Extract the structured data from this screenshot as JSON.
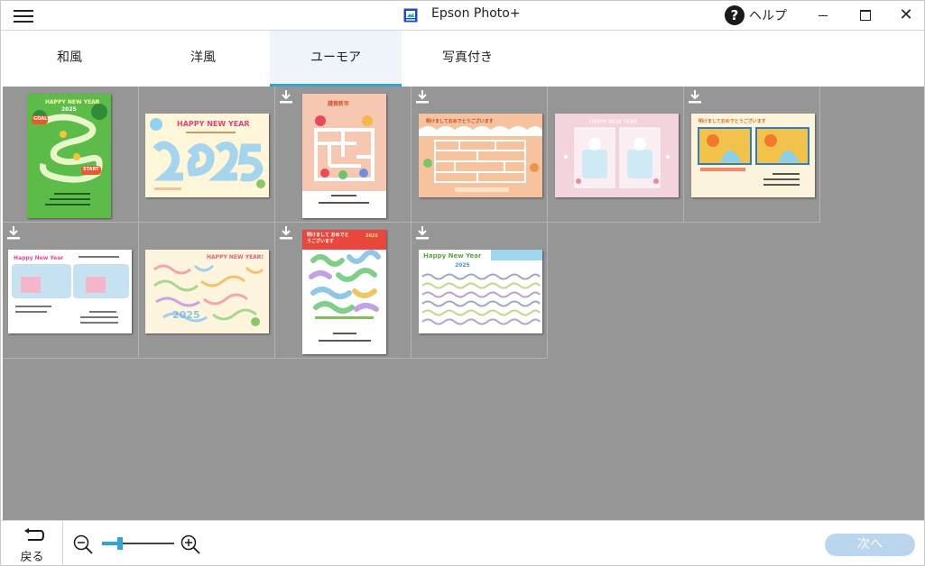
{
  "titlebar": {
    "title": "Epson Photo+",
    "help_label": "ヘルプ",
    "close_glyph": "✕"
  },
  "tabs": [
    {
      "label": "和風",
      "active": false
    },
    {
      "label": "洋風",
      "active": false
    },
    {
      "label": "ユーモア",
      "active": true
    },
    {
      "label": "写真付き",
      "active": false
    }
  ],
  "templates": [
    {
      "caption": "HAPPY NEW YEAR",
      "caption2": "2025",
      "tag_goal": "GOAL",
      "tag_start": "START",
      "downloadable": false,
      "bg": "#5dbb4a"
    },
    {
      "caption": "HAPPY NEW YEAR",
      "year": "2025",
      "downloadable": false,
      "bg": "#fdf6d8"
    },
    {
      "caption": "謹賀新年",
      "downloadable": true,
      "bg": "#f6c7b1"
    },
    {
      "caption": "明けましておめでとうございます",
      "downloadable": true,
      "bg": "#f6c39e"
    },
    {
      "caption": "HAPPY NEW YEAR",
      "downloadable": false,
      "bg": "#f3d3dc"
    },
    {
      "caption": "明けましておめでとうございます",
      "downloadable": true,
      "bg": "#fbf3dc"
    },
    {
      "caption": "Happy New Year",
      "downloadable": true,
      "bg": "#ffffff"
    },
    {
      "caption": "HAPPY NEW YEAR!",
      "year": "2025",
      "downloadable": false,
      "bg": "#fcf4dc"
    },
    {
      "caption": "明けまして おめでとうございます",
      "year": "2025",
      "downloadable": true,
      "bg": "#ffffff"
    },
    {
      "caption": "Happy New Year",
      "year": "2025",
      "downloadable": true,
      "bg": "#ffffff"
    }
  ],
  "footer": {
    "back_label": "戻る",
    "next_label": "次へ",
    "zoom_level": 0.25
  },
  "colors": {
    "accent": "#2fa4d8",
    "grid_bg": "#969696",
    "next_disabled": "#b9d6ee"
  }
}
